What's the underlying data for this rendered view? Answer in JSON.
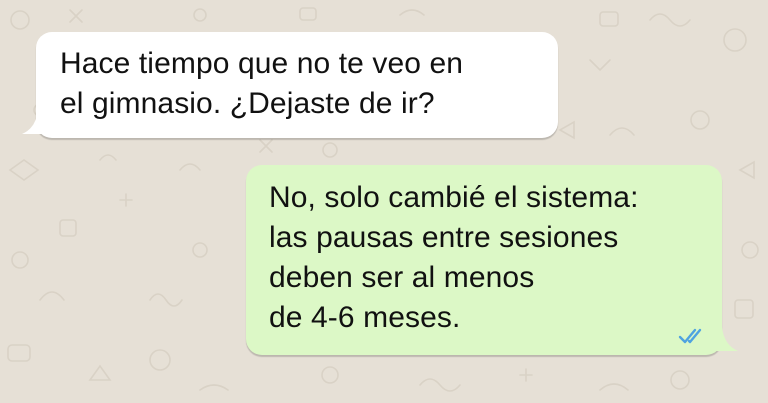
{
  "conversation": {
    "incoming": {
      "lines": [
        "Hace tiempo que no te veo en",
        "el gimnasio. ¿Dejaste de ir?"
      ]
    },
    "outgoing": {
      "lines": [
        "No, solo cambié el sistema:",
        "las pausas entre sesiones",
        "deben ser al menos",
        "de 4-6 meses."
      ],
      "status": "read-double-check-icon"
    }
  },
  "colors": {
    "background": "#e6e0d6",
    "incoming_bubble": "#ffffff",
    "outgoing_bubble": "#dcf8c6",
    "read_ticks": "#4fa3e0"
  }
}
